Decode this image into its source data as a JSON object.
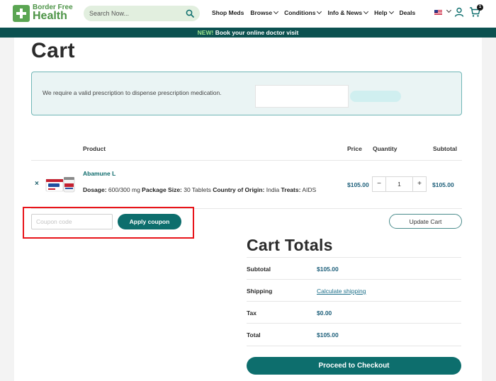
{
  "header": {
    "logo_top": "Border Free",
    "logo_bottom": "Health",
    "search_placeholder": "Search Now...",
    "nav": [
      {
        "label": "Shop Meds",
        "dropdown": false
      },
      {
        "label": "Browse",
        "dropdown": true
      },
      {
        "label": "Conditions",
        "dropdown": true
      },
      {
        "label": "Info & News",
        "dropdown": true
      },
      {
        "label": "Help",
        "dropdown": true
      },
      {
        "label": "Deals",
        "dropdown": false
      }
    ],
    "cart_count": "1"
  },
  "promo": {
    "new": "NEW!",
    "text": " Book your online doctor visit"
  },
  "page": {
    "title": "Cart",
    "rx_notice": "We require a valid prescription to dispense prescription medication."
  },
  "table": {
    "headers": {
      "product": "Product",
      "price": "Price",
      "quantity": "Quantity",
      "subtotal": "Subtotal"
    },
    "item": {
      "remove": "×",
      "name": "Abamune L",
      "dosage_label": "Dosage:",
      "dosage": " 600/300 mg ",
      "package_label": "Package Size:",
      "package": " 30 Tablets ",
      "origin_label": "Country of Origin:",
      "origin": " India ",
      "treats_label": "Treats:",
      "treats": " AIDS",
      "price": "$105.00",
      "quantity": "1",
      "minus": "−",
      "plus": "+",
      "subtotal": "$105.00"
    }
  },
  "coupon": {
    "placeholder": "Coupon code",
    "apply": "Apply coupon",
    "update": "Update Cart"
  },
  "totals": {
    "title": "Cart Totals",
    "subtotal_label": "Subtotal",
    "subtotal": "$105.00",
    "shipping_label": "Shipping",
    "shipping_link": "Calculate shipping",
    "tax_label": "Tax",
    "tax": "$0.00",
    "total_label": "Total",
    "total": "$105.00",
    "checkout": "Proceed to Checkout"
  },
  "colors": {
    "brand_green": "#4d9447",
    "teal": "#0d6e6d",
    "promo_bg": "#0b5150",
    "highlight": "#e8141a"
  }
}
